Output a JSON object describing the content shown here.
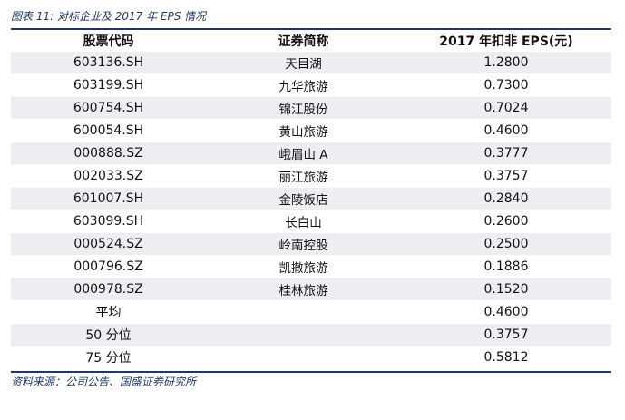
{
  "figure_title": "图表 11:  对标企业及 2017 年 EPS 情况",
  "headers": {
    "code": "股票代码",
    "name": "证券简称",
    "eps": "2017 年扣非 EPS(元)"
  },
  "rows": [
    {
      "code": "603136.SH",
      "name": "天目湖",
      "eps": "1.2800"
    },
    {
      "code": "603199.SH",
      "name": "九华旅游",
      "eps": "0.7300"
    },
    {
      "code": "600754.SH",
      "name": "锦江股份",
      "eps": "0.7024"
    },
    {
      "code": "600054.SH",
      "name": "黄山旅游",
      "eps": "0.4600"
    },
    {
      "code": "000888.SZ",
      "name": "峨眉山 A",
      "eps": "0.3777"
    },
    {
      "code": "002033.SZ",
      "name": "丽江旅游",
      "eps": "0.3757"
    },
    {
      "code": "601007.SH",
      "name": "金陵饭店",
      "eps": "0.2840"
    },
    {
      "code": "603099.SH",
      "name": "长白山",
      "eps": "0.2600"
    },
    {
      "code": "000524.SZ",
      "name": "岭南控股",
      "eps": "0.2500"
    },
    {
      "code": "000796.SZ",
      "name": "凯撒旅游",
      "eps": "0.1886"
    },
    {
      "code": "000978.SZ",
      "name": "桂林旅游",
      "eps": "0.1520"
    },
    {
      "code": "平均",
      "name": "",
      "eps": "0.4600"
    },
    {
      "code": "50 分位",
      "name": "",
      "eps": "0.3757"
    },
    {
      "code": "75 分位",
      "name": "",
      "eps": "0.5812"
    }
  ],
  "source": "资料来源：公司公告、国盛证券研究所",
  "colors": {
    "accent": "#1f3864",
    "stripe": "#eceef1"
  }
}
